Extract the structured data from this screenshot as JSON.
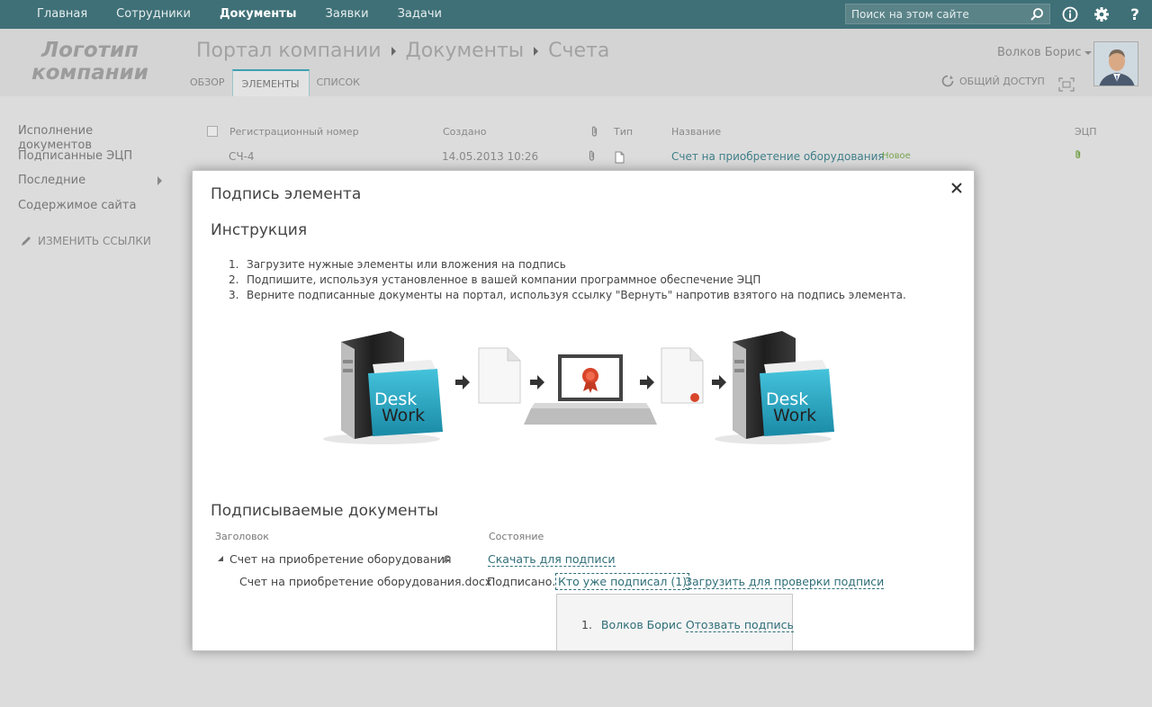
{
  "topnav": {
    "items": [
      "Главная",
      "Сотрудники",
      "Документы",
      "Заявки",
      "Задачи"
    ],
    "active": "Документы"
  },
  "search": {
    "placeholder": "Поиск на этом сайте"
  },
  "logo": {
    "line1": "Логотип",
    "line2": "компании"
  },
  "breadcrumb": [
    "Портал компании",
    "Документы",
    "Счета"
  ],
  "tabs": [
    "ОБЗОР",
    "ЭЛЕМЕНТЫ",
    "СПИСОК"
  ],
  "selected_tab": "ЭЛЕМЕНТЫ",
  "user": {
    "name": "Волков Борис"
  },
  "share": {
    "label": "ОБЩИЙ ДОСТУП"
  },
  "leftnav": {
    "items": [
      "Исполнение документов",
      "Подписанные ЭЦП",
      "Последние",
      "Содержимое сайта"
    ],
    "edit_links": "ИЗМЕНИТЬ ССЫЛКИ"
  },
  "list": {
    "headers": {
      "reg_number": "Регистрационный номер",
      "created": "Создано",
      "type": "Тип",
      "name": "Название",
      "ecp": "ЭЦП"
    },
    "row": {
      "reg_number": "СЧ-4",
      "created": "14.05.2013 10:26",
      "name": "Счет на приобретение оборудования",
      "badge": "Новое"
    }
  },
  "modal": {
    "title": "Подпись элемента",
    "instruction_heading": "Инструкция",
    "steps": [
      "Загрузите нужные элементы или вложения на подпись",
      "Подпишите, используя установленное в вашей компании программное обеспечение ЭЦП",
      "Верните подписанные документы на портал, используя ссылку \"Вернуть\" напротив взятого на подпись элемента."
    ],
    "diagram": {
      "brand_line1": "Desk",
      "brand_line2": "Work"
    },
    "docs_heading": "Подписываемые документы",
    "col_title": "Заголовок",
    "col_status": "Состояние",
    "group_name": "Счет на приобретение оборудования",
    "download_link": "Скачать для подписи",
    "file_name": "Счет на приобретение оборудования.docx",
    "status_text": "Подписано.",
    "who_signed_link": "Кто уже подписал (1)",
    "upload_link": "Загрузить для проверки подписи",
    "signers": [
      {
        "num": "1.",
        "name": "Волков Борис",
        "revoke": "Отозвать подпись"
      }
    ]
  },
  "colors": {
    "topbar": "#3f7077",
    "link": "#2f6e78",
    "badge": "#77a34e"
  }
}
